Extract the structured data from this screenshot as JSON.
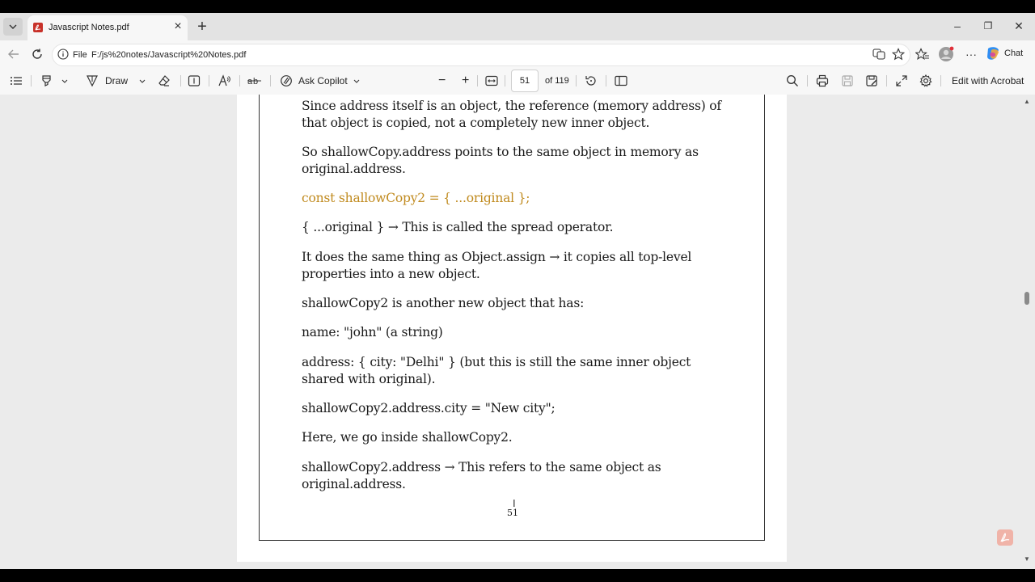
{
  "browser": {
    "tab": {
      "title": "Javascript Notes.pdf"
    },
    "new_tab_symbol": "+",
    "window_controls": {
      "minimize": "–",
      "restore": "❐",
      "close": "✕"
    },
    "address": {
      "scheme": "File",
      "url": "F:/js%20notes/Javascript%20Notes.pdf"
    },
    "chat_label": "Chat"
  },
  "toolbar": {
    "draw_label": "Draw",
    "ask_copilot_label": "Ask Copilot",
    "zoom_out": "−",
    "zoom_in": "+",
    "page_current": "51",
    "page_total": "of 119",
    "edit_acrobat_label": "Edit with Acrobat"
  },
  "document": {
    "paragraphs": [
      "Since address itself is an object, the reference (memory address) of that object is copied, not a completely new inner object.",
      "So shallowCopy.address points to the same object in memory as original.address.",
      "const shallowCopy2 = { ...original };",
      "{ ...original } → This is called the spread operator.",
      "It does the same thing as Object.assign → it copies all top-level properties into a new object.",
      "shallowCopy2 is another new object that has:",
      "name: \"john\" (a string)",
      "address: { city: \"Delhi\" } (but this is still the same inner object shared with original).",
      "shallowCopy2.address.city = \"New city\";",
      "Here, we go inside shallowCopy2.",
      "shallowCopy2.address → This refers to the same object as original.address."
    ],
    "page_number": "51",
    "code_color": "#c08a1e"
  }
}
